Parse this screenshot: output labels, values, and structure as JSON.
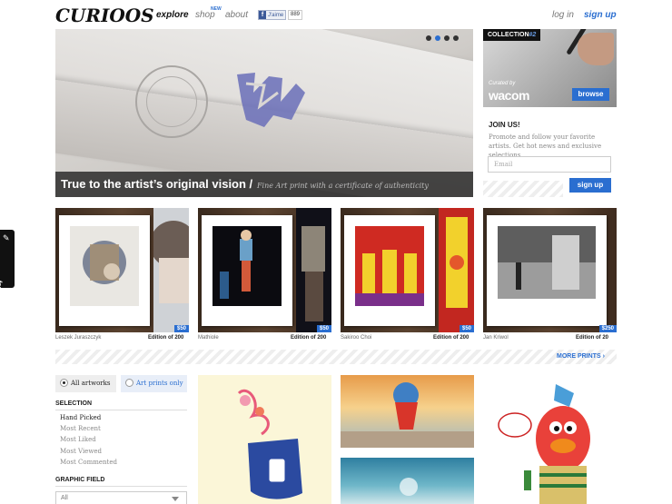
{
  "header": {
    "logo": "CURIOOS",
    "nav": {
      "explore": "explore",
      "shop": "shop",
      "shop_badge": "NEW",
      "about": "about"
    },
    "facebook": {
      "label": "J'aime",
      "count": "889"
    },
    "login": "log in",
    "signup": "sign up"
  },
  "hero": {
    "title": "True to the artist’s original vision /",
    "subtitle": "Fine Art print with a certificate of authenticity",
    "slides": 4,
    "active_slide": 2
  },
  "collection": {
    "label": "COLLECTION",
    "number": "#2",
    "curated_by": "Curated by",
    "brand": "wacom",
    "browse": "browse"
  },
  "join": {
    "title": "JOIN US!",
    "text": "Promote and follow your favorite artists. Get hot news and exclusive selections.",
    "email_placeholder": "Email",
    "button": "sign up"
  },
  "prints": [
    {
      "artist": "Leszek Juraszczyk",
      "edition": "Edition of 200",
      "price": "$50"
    },
    {
      "artist": "Mathiole",
      "edition": "Edition of 200",
      "price": "$50"
    },
    {
      "artist": "Sakiroo Choi",
      "edition": "Edition of 200",
      "price": "$50"
    },
    {
      "artist": "Jan Kriwol",
      "edition": "Edition of 20",
      "price": "$250"
    }
  ],
  "more_prints": "MORE PRINTS",
  "filters": {
    "all_artworks": "All artworks",
    "art_prints_only": "Art prints only",
    "selection_title": "SELECTION",
    "selection": [
      "Hand Picked",
      "Most Recent",
      "Most Liked",
      "Most Viewed",
      "Most Commented"
    ],
    "graphic_field_title": "GRAPHIC FIELD",
    "graphic_field_value": "All"
  },
  "feedback": "feedback",
  "colors": {
    "accent": "#2a6ed0",
    "dark": "#111111"
  }
}
